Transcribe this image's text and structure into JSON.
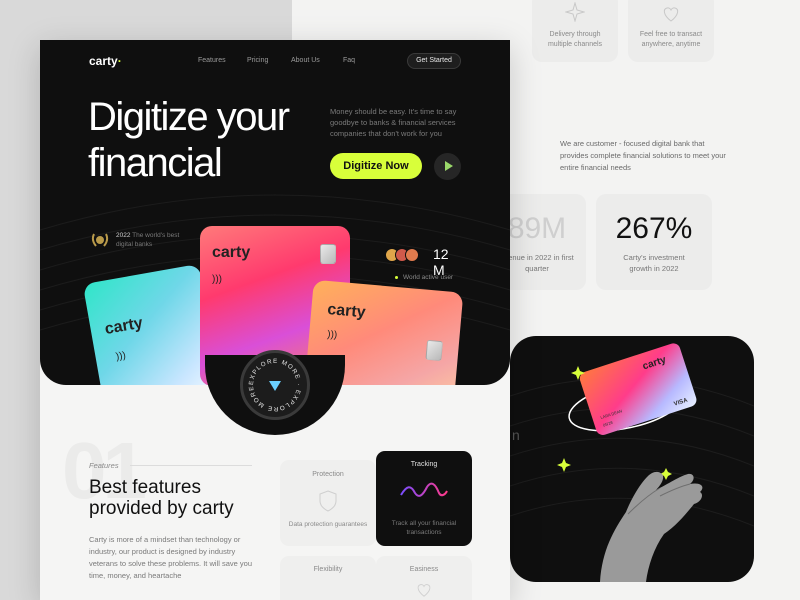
{
  "back_page": {
    "feature_cards": [
      {
        "text": "Delivery through multiple channels",
        "icon": "sparkle-icon"
      },
      {
        "text": "Feel free to transact anywhere, anytime",
        "icon": "heart-icon"
      }
    ],
    "about_text": "We are  customer - focused digital bank that provides complete financial solutions to meet your entire financial needs",
    "stats": [
      {
        "value": "89M",
        "label": "evenue in 2022 in first quarter"
      },
      {
        "value": "267%",
        "label": "Carty's investment growth in 2022"
      }
    ],
    "visual": {
      "card_logo": "carty",
      "holder_name": "LARA DEAN",
      "expiry": "05/28",
      "network": "VISA",
      "fragment_letter": "n"
    }
  },
  "header": {
    "logo": "carty",
    "nav": [
      "Features",
      "Pricing",
      "About Us",
      "Faq"
    ],
    "cta": "Get Started"
  },
  "hero": {
    "headline_line1": "Digitize your",
    "headline_line2": "financial",
    "description": "Money should be easy. It's time to say goodbye to banks & financial services companies that don't work for you",
    "primary_button": "Digitize Now",
    "award_year": "2022",
    "award_text": "The world's best digital banks",
    "users_count": "12 M",
    "users_label": "World active user",
    "card_logo": "carty",
    "explore_badge": "EXPLORE MORE · EXPLORE MORE ·"
  },
  "features": {
    "section_number": "01",
    "label": "Features",
    "title_line1": "Best features",
    "title_line2": "provided by carty",
    "description": "Carty is more of a mindset than technology or industry, our product is designed by industry veterans to solve these problems. It will save you time, money, and heartache",
    "cards": [
      {
        "title": "Protection",
        "text": "Data protection guarantees",
        "icon": "shield-icon",
        "dark": false
      },
      {
        "title": "Tracking",
        "text": "Track all your financial transactions",
        "icon": "wave-chart-icon",
        "dark": true
      },
      {
        "title": "Flexibility",
        "text": "",
        "icon": "flex-icon",
        "dark": false
      },
      {
        "title": "Easiness",
        "text": "",
        "icon": "heart-icon",
        "dark": false
      }
    ]
  },
  "colors": {
    "accent": "#d8ff3a",
    "dark": "#0f0f0f",
    "page_bg": "#f5f5f4"
  }
}
